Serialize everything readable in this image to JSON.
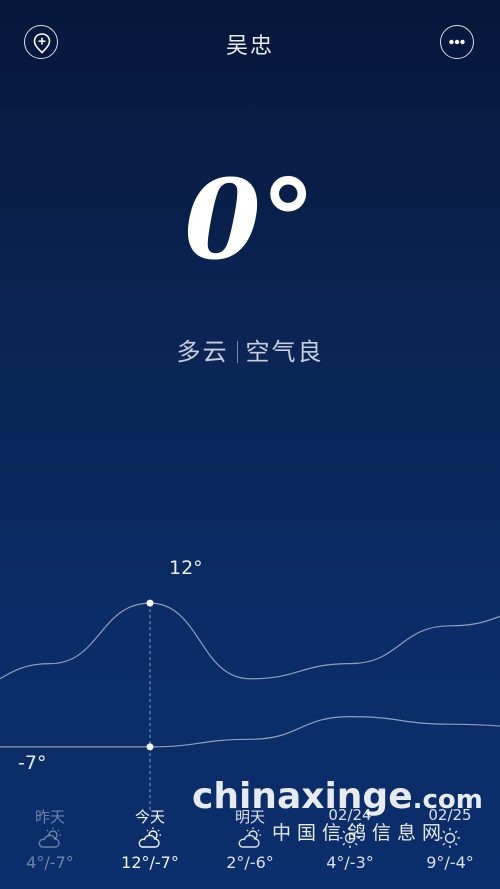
{
  "header": {
    "city": "吴忠",
    "add_location_icon": "location-plus-icon",
    "more_icon": "more-dots-icon"
  },
  "current": {
    "temperature": "0°",
    "condition": "多云",
    "air_quality": "空气良"
  },
  "chart_data": {
    "type": "line",
    "x": [
      "昨天",
      "今天",
      "明天",
      "02/24",
      "02/25"
    ],
    "series": [
      {
        "values": [
          4,
          12,
          2,
          4,
          9
        ]
      },
      {
        "values": [
          -7,
          -7,
          -6,
          -3,
          -4
        ]
      }
    ],
    "annotations": {
      "high_label": "12°",
      "low_label": "-7°"
    }
  },
  "forecast": [
    {
      "day": "昨天",
      "icon": "partly-cloudy-icon",
      "range": "4°/-7°",
      "state": "past"
    },
    {
      "day": "今天",
      "icon": "partly-cloudy-icon",
      "range": "12°/-7°",
      "state": "current"
    },
    {
      "day": "明天",
      "icon": "partly-cloudy-icon",
      "range": "2°/-6°",
      "state": "future"
    },
    {
      "day": "02/24",
      "icon": "sunny-icon",
      "range": "4°/-3°",
      "state": "future"
    },
    {
      "day": "02/25",
      "icon": "sunny-icon",
      "range": "9°/-4°",
      "state": "future"
    }
  ],
  "watermark": {
    "main": "chinaxinge",
    "suffix": ".com",
    "sub": "中国信鸽信息网"
  }
}
